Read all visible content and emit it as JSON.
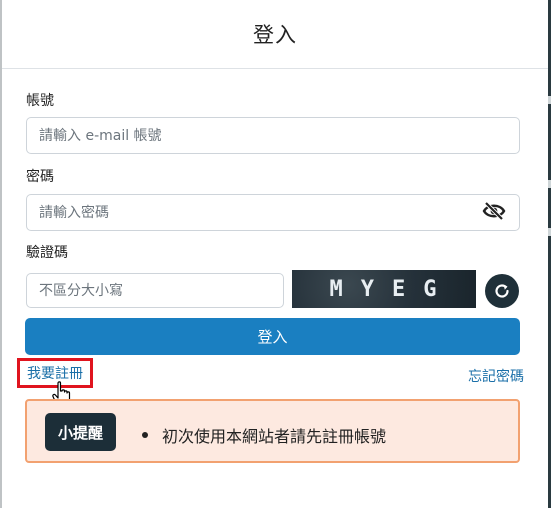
{
  "modal": {
    "title": "登入"
  },
  "account": {
    "label": "帳號",
    "placeholder": "請輸入 e-mail 帳號"
  },
  "password": {
    "label": "密碼",
    "placeholder": "請輸入密碼",
    "toggle_icon": "eye-slash-icon"
  },
  "captcha": {
    "label": "驗證碼",
    "placeholder": "不區分大小寫",
    "image_text": "MYEG",
    "refresh_icon": "refresh-icon"
  },
  "actions": {
    "login_label": "登入",
    "register_label": "我要註冊",
    "forgot_label": "忘記密碼"
  },
  "tip": {
    "badge": "小提醒",
    "items": [
      "初次使用本網站者請先註冊帳號"
    ]
  },
  "colors": {
    "primary": "#1a7fc1",
    "link": "#1a6fa8",
    "dark": "#1c2e38",
    "tip_bg": "#fde9e0",
    "tip_border": "#f2a170",
    "highlight": "#e0141e"
  }
}
